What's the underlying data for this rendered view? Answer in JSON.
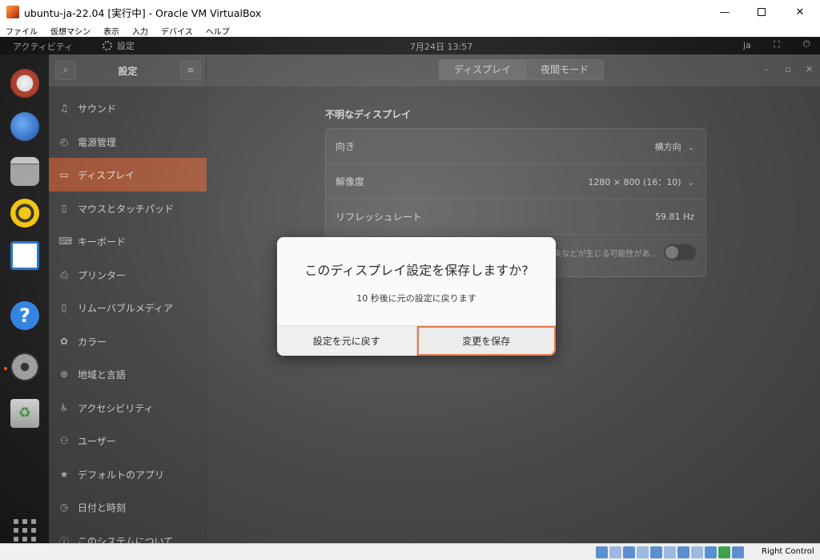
{
  "host_window": {
    "title": "ubuntu-ja-22.04 [実行中] - Oracle VM VirtualBox",
    "minimize": "—",
    "close": "✕"
  },
  "host_menu": [
    "ファイル",
    "仮想マシン",
    "表示",
    "入力",
    "デバイス",
    "ヘルプ"
  ],
  "topbar": {
    "activities": "アクティビティ",
    "app_name": "設定",
    "clock": "7月24日  13:57",
    "lang": "ja",
    "net_icon": "⛶",
    "power_icon": "⏻"
  },
  "settings": {
    "title": "設定",
    "search_icon": "⌕",
    "menu_icon": "≡",
    "tabs": [
      {
        "label": "ディスプレイ",
        "active": true
      },
      {
        "label": "夜間モード",
        "active": false
      }
    ],
    "window_controls": [
      "–",
      "▫",
      "✕"
    ],
    "sidebar": [
      {
        "icon": "♫",
        "label": "サウンド"
      },
      {
        "icon": "◴",
        "label": "電源管理"
      },
      {
        "icon": "▭",
        "label": "ディスプレイ",
        "selected": true
      },
      {
        "icon": "▯",
        "label": "マウスとタッチパッド"
      },
      {
        "icon": "⌨",
        "label": "キーボード"
      },
      {
        "icon": "⎙",
        "label": "プリンター"
      },
      {
        "icon": "▯",
        "label": "リムーバブルメディア"
      },
      {
        "icon": "✿",
        "label": "カラー"
      },
      {
        "icon": "⊕",
        "label": "地域と言語"
      },
      {
        "icon": "♿",
        "label": "アクセシビリティ"
      },
      {
        "icon": "⚇",
        "label": "ユーザー"
      },
      {
        "icon": "★",
        "label": "デフォルトのアプリ"
      },
      {
        "icon": "◷",
        "label": "日付と時刻"
      },
      {
        "icon": "ⓘ",
        "label": "このシステムについて"
      }
    ],
    "section_title": "不明なディスプレイ",
    "rows": {
      "orientation": {
        "label": "向き",
        "value": "横方向"
      },
      "resolution": {
        "label": "解像度",
        "value": "1280 × 800 (16：10)"
      },
      "refresh": {
        "label": "リフレッシュレート",
        "value": "59.81 Hz"
      },
      "fractional_hint": "失などが生じる可能性があ..."
    },
    "chevron": "⌄"
  },
  "dialog": {
    "title": "このディスプレイ設定を保存しますか?",
    "subtitle": "10 秒後に元の設定に戻ります",
    "cancel_label": "設定を元に戻す",
    "save_label": "変更を保存"
  },
  "statusbar": {
    "host_key": "Right Control"
  },
  "colors": {
    "accent": "#e95420",
    "selected_dim": "#9a4a2a",
    "focus_outline": "#e97a4e"
  }
}
